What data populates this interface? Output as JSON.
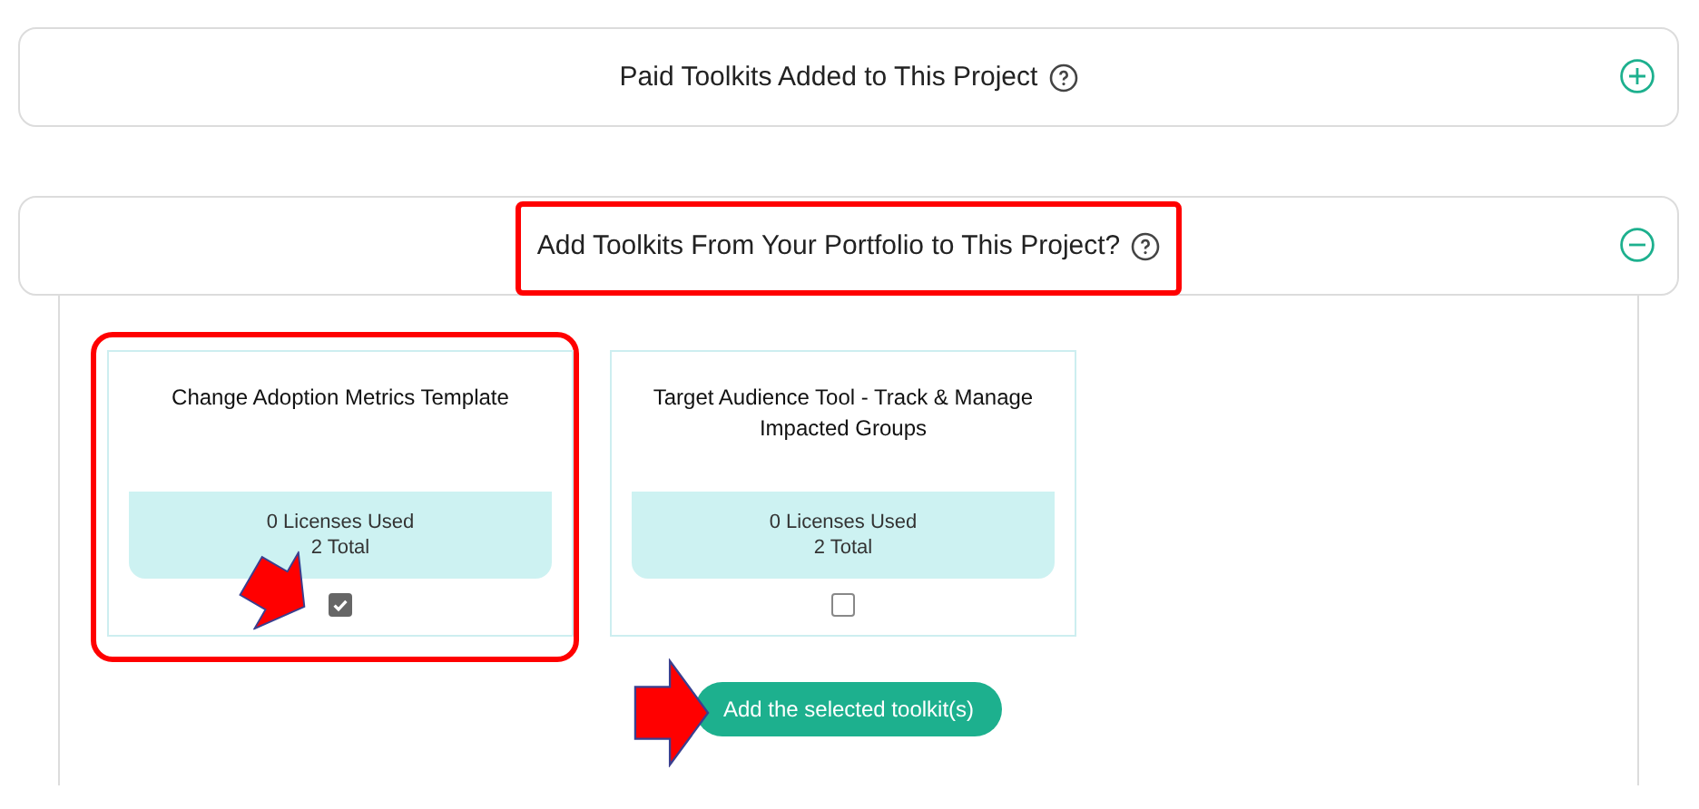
{
  "sections": [
    {
      "title": "Paid Toolkits Added to This Project",
      "expanded": false,
      "highlighted": false
    },
    {
      "title": "Add Toolkits From Your Portfolio to This Project?",
      "expanded": true,
      "highlighted": true,
      "toolkits": [
        {
          "name": "Change Adoption Metrics Template",
          "licenses_used": "0 Licenses Used",
          "total": "2 Total",
          "checked": true,
          "highlighted": true,
          "pointed": true
        },
        {
          "name": "Target Audience Tool - Track & Manage Impacted Groups",
          "licenses_used": "0 Licenses Used",
          "total": "2 Total",
          "checked": false,
          "highlighted": false,
          "pointed": false
        }
      ],
      "button": {
        "label": "Add the selected toolkit(s)",
        "pointed": true
      }
    }
  ]
}
